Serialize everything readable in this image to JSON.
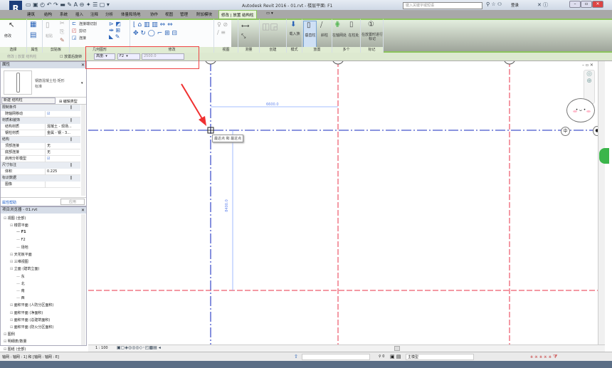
{
  "app": {
    "title": "Autodesk Revit 2016 -    01.rvt - 楼层平面: F1",
    "search_placeholder": "键入关键字或短语",
    "login": "登录"
  },
  "tabs": [
    "建筑",
    "结构",
    "系统",
    "插入",
    "注释",
    "分析",
    "体量和场地",
    "协作",
    "视图",
    "管理",
    "附加模块",
    "修改 | 放置 结构柱"
  ],
  "ribbon": {
    "buttons": {
      "modify": "修改",
      "paste": "粘贴",
      "cope": "连接端切割",
      "cut": "剪切",
      "join": "连接",
      "load_family": "载入族",
      "vertical_column": "垂直柱",
      "slanted_column": "斜柱",
      "at_grids": "在轴网处",
      "at_columns": "在柱处",
      "tag_on_placement": "在放置时进行标记"
    },
    "panels": [
      "选择",
      "属性",
      "剪贴板",
      "几何图形",
      "修改",
      "视图",
      "测量",
      "创建",
      "模式",
      "放置",
      "多个",
      "标记"
    ]
  },
  "options_bar": {
    "context": "修改 | 放置 结构柱",
    "rotate_after_place": "放置后旋转",
    "depth_mode": "高度:",
    "level": "F2",
    "offset": "2500.0"
  },
  "properties": {
    "title": "属性",
    "type_name": "钢筋混凝土柱-矩形",
    "type_sub": "标准",
    "new_selector": "新建 结构柱",
    "edit_type": "编辑类型",
    "categories": [
      {
        "name": "限制条件",
        "rows": [
          {
            "k": "随轴网移动",
            "v": "☑"
          }
        ]
      },
      {
        "name": "材质和装饰",
        "rows": [
          {
            "k": "结构材质",
            "v": "混凝土 - 现场..."
          },
          {
            "k": "钢柱材质",
            "v": "金属 - 钢 - 3..."
          }
        ]
      },
      {
        "name": "结构",
        "rows": [
          {
            "k": "顶部连接",
            "v": "无"
          },
          {
            "k": "底部连接",
            "v": "无"
          },
          {
            "k": "启用分析模型",
            "v": "☑"
          }
        ]
      },
      {
        "name": "尺寸标注",
        "rows": [
          {
            "k": "体积",
            "v": "0.225"
          }
        ]
      },
      {
        "name": "标识数据",
        "rows": [
          {
            "k": "图像",
            "v": ""
          }
        ]
      }
    ],
    "help_link": "属性帮助",
    "apply": "应用"
  },
  "browser": {
    "title": "项目浏览器 - 01.rvt",
    "nodes": [
      "视图 (全部)",
      "楼层平面",
      "F1",
      "F2",
      "场地",
      "天花板平面",
      "三维视图",
      "立面 (建筑立面)",
      "东",
      "北",
      "南",
      "西",
      "面积平面 (人防分区面积)",
      "面积平面 (净面积)",
      "面积平面 (总建筑面积)",
      "面积平面 (防火分区面积)",
      "图例",
      "明细表/数量",
      "图纸 (全部)"
    ]
  },
  "canvas": {
    "dim_horizontal": "6600.0",
    "dim_vertical": "8400.0",
    "snap_tooltip": "最近点 和 最近点",
    "grid_color": "#3344cc",
    "ref_color": "#e8334a"
  },
  "view_bar": {
    "scale": "1 : 100"
  },
  "status": {
    "text": "轴网 : 轴网 : 1] 和 [轴网 : 轴网 : E]",
    "detail_value": "0",
    "model": "主模型"
  }
}
